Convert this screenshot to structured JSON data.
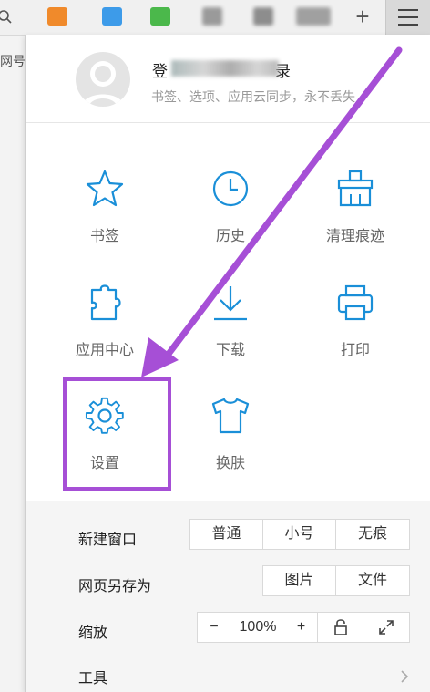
{
  "toolbar": {
    "plus_label": "+",
    "ext_colors": [
      "#f08a2b",
      "#3d9be9",
      "#4bb84b",
      "#9a9a9a",
      "#8d8d8d",
      "#a0a0a0"
    ]
  },
  "page_tab": {
    "label": "网号"
  },
  "user": {
    "login_label": "登",
    "login_tail": "录",
    "subtitle": "书签、选项、应用云同步，永不丢失"
  },
  "grid": [
    {
      "label": "书签",
      "icon": "star-icon"
    },
    {
      "label": "历史",
      "icon": "clock-icon"
    },
    {
      "label": "清理痕迹",
      "icon": "clean-icon"
    },
    {
      "label": "应用中心",
      "icon": "puzzle-icon"
    },
    {
      "label": "下载",
      "icon": "download-icon"
    },
    {
      "label": "打印",
      "icon": "printer-icon"
    },
    {
      "label": "设置",
      "icon": "gear-icon"
    },
    {
      "label": "换肤",
      "icon": "shirt-icon"
    }
  ],
  "new_window": {
    "label": "新建窗口",
    "options": [
      "普通",
      "小号",
      "无痕"
    ]
  },
  "save_as": {
    "label": "网页另存为",
    "options": [
      "图片",
      "文件"
    ]
  },
  "zoom": {
    "label": "缩放",
    "minus": "−",
    "value": "100%",
    "plus": "+"
  },
  "tools": {
    "label": "工具"
  },
  "colors": {
    "accent": "#1a8fd8",
    "annotation": "#a64fd6"
  }
}
